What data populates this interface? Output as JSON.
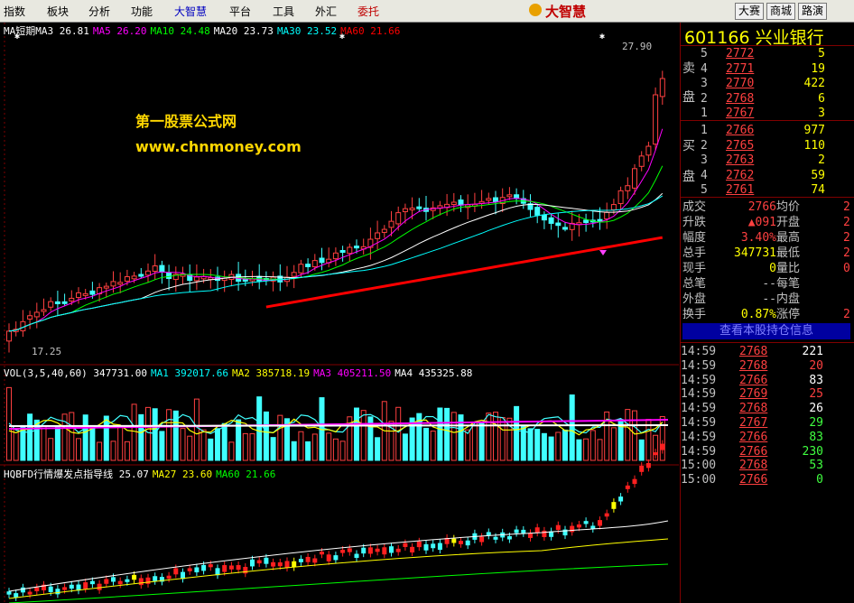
{
  "menu": {
    "items": [
      "指数",
      "板块",
      "分析",
      "功能",
      "大智慧",
      "平台",
      "工具",
      "外汇",
      "委托"
    ],
    "logo": "大智慧",
    "right_buttons": [
      "大赛",
      "商城",
      "路演"
    ]
  },
  "chart": {
    "main_legend": [
      {
        "label": "MA短期MA3",
        "value": "26.81",
        "color": "#ffffff"
      },
      {
        "label": "MA5",
        "value": "26.20",
        "color": "#ff00ff"
      },
      {
        "label": "MA10",
        "value": "24.48",
        "color": "#00ff00"
      },
      {
        "label": "MA20",
        "value": "23.73",
        "color": "#ffffff"
      },
      {
        "label": "MA30",
        "value": "23.52",
        "color": "#00ffff"
      },
      {
        "label": "MA60",
        "value": "21.66",
        "color": "#ff0000"
      }
    ],
    "price_high": "27.90",
    "price_low": "17.25",
    "watermark_cn": "第一股票公式网",
    "watermark_url": "www.chnmoney.com",
    "vol_legend": [
      {
        "label": "VOL(3,5,40,60)",
        "value": "347731.00",
        "color": "#ffffff"
      },
      {
        "label": "MA1",
        "value": "392017.66",
        "color": "#00ffff"
      },
      {
        "label": "MA2",
        "value": "385718.19",
        "color": "#ffff00"
      },
      {
        "label": "MA3",
        "value": "405211.50",
        "color": "#ff00ff"
      },
      {
        "label": "MA4",
        "value": "435325.88",
        "color": "#ffffff"
      }
    ],
    "ind_legend": [
      {
        "label": "HQBFD行情爆发点指导线",
        "value": "25.07",
        "color": "#ffffff"
      },
      {
        "label": "MA27",
        "value": "23.60",
        "color": "#ffff00"
      },
      {
        "label": "MA60",
        "value": "21.66",
        "color": "#00ff00"
      }
    ]
  },
  "quote": {
    "code": "601166",
    "name": "兴业银行",
    "sell_label": [
      "卖",
      "盘"
    ],
    "buy_label": [
      "买",
      "盘"
    ],
    "sell": [
      {
        "lvl": "5",
        "price": "2772",
        "vol": "5"
      },
      {
        "lvl": "4",
        "price": "2771",
        "vol": "19"
      },
      {
        "lvl": "3",
        "price": "2770",
        "vol": "422"
      },
      {
        "lvl": "2",
        "price": "2768",
        "vol": "6"
      },
      {
        "lvl": "1",
        "price": "2767",
        "vol": "3"
      }
    ],
    "buy": [
      {
        "lvl": "1",
        "price": "2766",
        "vol": "977"
      },
      {
        "lvl": "2",
        "price": "2765",
        "vol": "110"
      },
      {
        "lvl": "3",
        "price": "2763",
        "vol": "2"
      },
      {
        "lvl": "4",
        "price": "2762",
        "vol": "59"
      },
      {
        "lvl": "5",
        "price": "2761",
        "vol": "74"
      }
    ],
    "stats": [
      {
        "k1": "成交",
        "v1": "2766",
        "c1": "#ff4040",
        "k2": "均价",
        "v2": "2"
      },
      {
        "k1": "升跌",
        "v1": "▲091",
        "c1": "#ff4040",
        "k2": "开盘",
        "v2": "2"
      },
      {
        "k1": "幅度",
        "v1": "3.40%",
        "c1": "#ff4040",
        "k2": "最高",
        "v2": "2"
      },
      {
        "k1": "总手",
        "v1": "347731",
        "c1": "#ffff00",
        "k2": "最低",
        "v2": "2"
      },
      {
        "k1": "现手",
        "v1": "0",
        "c1": "#ffff00",
        "k2": "量比",
        "v2": "0"
      },
      {
        "k1": "总笔",
        "v1": "--",
        "c1": "#c0c0c0",
        "k2": "每笔",
        "v2": ""
      },
      {
        "k1": "外盘",
        "v1": "--",
        "c1": "#c0c0c0",
        "k2": "内盘",
        "v2": ""
      },
      {
        "k1": "换手",
        "v1": "0.87%",
        "c1": "#ffff00",
        "k2": "涨停",
        "v2": "2"
      }
    ],
    "holdings_btn": "查看本股持仓信息",
    "ticks": [
      {
        "t": "14:59",
        "p": "2768",
        "v": "221",
        "c": "#ffffff"
      },
      {
        "t": "14:59",
        "p": "2768",
        "v": "20",
        "c": "#ff4040"
      },
      {
        "t": "14:59",
        "p": "2766",
        "v": "83",
        "c": "#ffffff"
      },
      {
        "t": "14:59",
        "p": "2769",
        "v": "25",
        "c": "#ff4040"
      },
      {
        "t": "14:59",
        "p": "2768",
        "v": "26",
        "c": "#ffffff"
      },
      {
        "t": "14:59",
        "p": "2767",
        "v": "29",
        "c": "#40ff40"
      },
      {
        "t": "14:59",
        "p": "2766",
        "v": "83",
        "c": "#40ff40"
      },
      {
        "t": "14:59",
        "p": "2766",
        "v": "230",
        "c": "#40ff40"
      },
      {
        "t": "15:00",
        "p": "2768",
        "v": "53",
        "c": "#40ff40"
      },
      {
        "t": "15:00",
        "p": "2766",
        "v": "0",
        "c": "#40ff40"
      }
    ]
  }
}
